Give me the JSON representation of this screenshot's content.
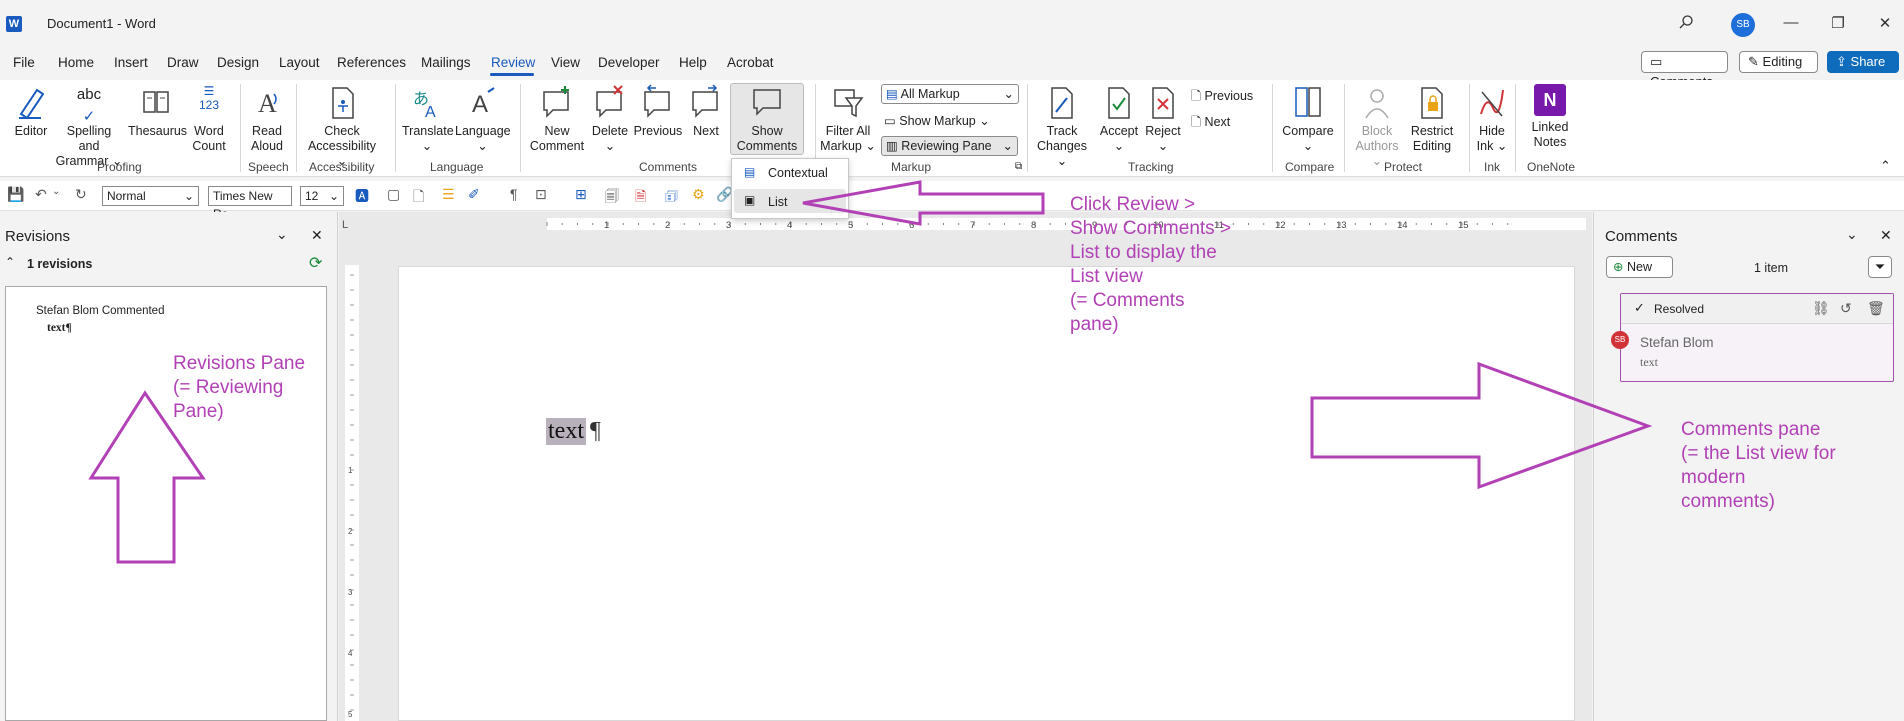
{
  "titlebar": {
    "app_icon_letter": "W",
    "title": "Document1  -  Word",
    "avatar_initials": "SB",
    "search_icon": "search-icon",
    "minimize": "—",
    "restore": "❐",
    "close": "✕"
  },
  "menu": {
    "tabs": [
      "File",
      "Home",
      "Insert",
      "Draw",
      "Design",
      "Layout",
      "References",
      "Mailings",
      "Review",
      "View",
      "Developer",
      "Help",
      "Acrobat"
    ],
    "active": "Review",
    "comments_btn": "Comments",
    "editing_btn": "Editing",
    "share_btn": "Share"
  },
  "ribbon": {
    "proofing": {
      "label": "Proofing",
      "editor": "Editor",
      "spelling": "Spelling and Grammar",
      "thesaurus": "Thesaurus",
      "word_count": "Word Count",
      "abc": "abc",
      "num": "123"
    },
    "speech": {
      "label": "Speech",
      "read_aloud": "Read Aloud"
    },
    "accessibility": {
      "label": "Accessibility",
      "check": "Check Accessibility"
    },
    "language": {
      "label": "Language",
      "translate": "Translate",
      "language": "Language"
    },
    "comments": {
      "label": "Comments",
      "new": "New Comment",
      "delete": "Delete",
      "previous": "Previous",
      "next": "Next",
      "show": "Show Comments"
    },
    "markup": {
      "label": "Markup",
      "filter": "Filter All Markup",
      "all_markup": "All Markup",
      "show_markup": "Show Markup",
      "reviewing_pane": "Reviewing Pane"
    },
    "tracking": {
      "label": "Tracking",
      "track": "Track Changes",
      "accept": "Accept",
      "reject": "Reject",
      "previous": "Previous",
      "next": "Next"
    },
    "compare": {
      "label": "Compare",
      "compare": "Compare"
    },
    "protect": {
      "label": "Protect",
      "block": "Block Authors",
      "restrict": "Restrict Editing"
    },
    "ink": {
      "label": "Ink",
      "hide": "Hide Ink"
    },
    "onenote": {
      "label": "OneNote",
      "linked": "Linked Notes"
    }
  },
  "qat": {
    "style": "Normal",
    "font": "Times New Ro",
    "size": "12"
  },
  "dropdown": {
    "contextual": "Contextual",
    "list": "List"
  },
  "revisions": {
    "title": "Revisions",
    "count": "1 revisions",
    "author_line": "Stefan Blom Commented",
    "text": "text¶"
  },
  "document": {
    "text": "text",
    "pilcrow": "¶",
    "ruler_numbers": [
      "1",
      "2",
      "3",
      "4",
      "5",
      "6",
      "7",
      "8",
      "9",
      "10",
      "11",
      "12",
      "13",
      "14",
      "15"
    ],
    "vruler_numbers": [
      "1",
      "2",
      "3",
      "4",
      "5"
    ]
  },
  "comments_pane": {
    "title": "Comments",
    "new_btn": "New",
    "count": "1 item",
    "card": {
      "status": "Resolved",
      "initials": "SB",
      "author": "Stefan Blom",
      "body": "text"
    }
  },
  "annotations": {
    "review_note": [
      "Click Review >",
      "Show Comments >",
      "List to display the",
      "List view",
      "(= Comments",
      "pane)"
    ],
    "revisions_note": [
      "Revisions Pane",
      "(= Reviewing",
      "Pane)"
    ],
    "comments_note": [
      "Comments pane",
      "(= the List view for",
      "modern",
      "comments)"
    ],
    "color": "#b141b5"
  },
  "colors": {
    "accent": "#185abd",
    "share": "#0f6cbd",
    "annotation": "#b141b5"
  }
}
